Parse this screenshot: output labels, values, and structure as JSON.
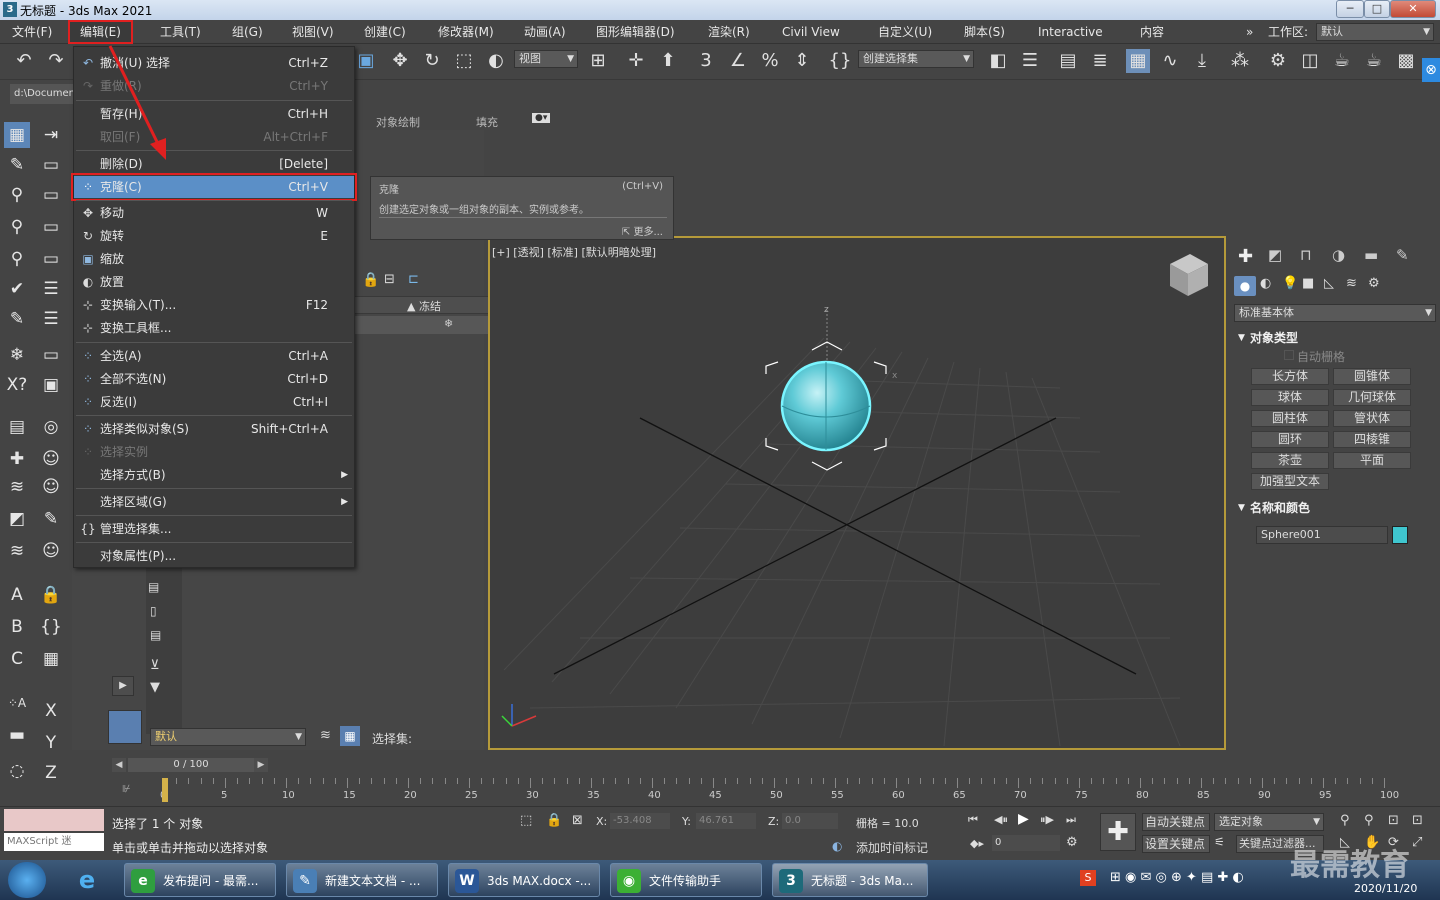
{
  "window": {
    "title": "无标题 - 3ds Max 2021",
    "app_icon": "3",
    "minimize": "─",
    "maximize": "□",
    "close": "✕"
  },
  "menubar": {
    "items": [
      "文件(F)",
      "编辑(E)",
      "工具(T)",
      "组(G)",
      "视图(V)",
      "创建(C)",
      "修改器(M)",
      "动画(A)",
      "图形编辑器(D)",
      "渲染(R)",
      "Civil View",
      "自定义(U)",
      "脚本(S)",
      "Interactive",
      "内容"
    ],
    "workspace_label": "工作区:",
    "workspace_value": "默认",
    "more": "»"
  },
  "toolbar": {
    "view_combo": "视图",
    "selection_set_combo": "创建选择集",
    "path": "d:\\Documents"
  },
  "ribbon": {
    "tab_object_paint": "对象绘制",
    "tab_fill": "填充"
  },
  "edit_menu": {
    "items": [
      {
        "label": "撤消(U) 选择",
        "shortcut": "Ctrl+Z",
        "icon": "↶",
        "disabled": false
      },
      {
        "label": "重做(R)",
        "shortcut": "Ctrl+Y",
        "icon": "↷",
        "disabled": true
      },
      {
        "label": "暂存(H)",
        "shortcut": "Ctrl+H",
        "icon": "",
        "disabled": false
      },
      {
        "label": "取回(F)",
        "shortcut": "Alt+Ctrl+F",
        "icon": "",
        "disabled": true
      },
      {
        "label": "删除(D)",
        "shortcut": "[Delete]",
        "icon": "",
        "disabled": false
      },
      {
        "label": "克隆(C)",
        "shortcut": "Ctrl+V",
        "icon": "⁘",
        "disabled": false
      },
      {
        "label": "移动",
        "shortcut": "W",
        "icon": "✥",
        "disabled": false
      },
      {
        "label": "旋转",
        "shortcut": "E",
        "icon": "↻",
        "disabled": false
      },
      {
        "label": "缩放",
        "shortcut": "",
        "icon": "▣",
        "disabled": false
      },
      {
        "label": "放置",
        "shortcut": "",
        "icon": "◐",
        "disabled": false
      },
      {
        "label": "变换输入(T)...",
        "shortcut": "F12",
        "icon": "⊹",
        "disabled": false
      },
      {
        "label": "变换工具框...",
        "shortcut": "",
        "icon": "⊹",
        "disabled": false
      },
      {
        "label": "全选(A)",
        "shortcut": "Ctrl+A",
        "icon": "⁘",
        "disabled": false
      },
      {
        "label": "全部不选(N)",
        "shortcut": "Ctrl+D",
        "icon": "⁘",
        "disabled": false
      },
      {
        "label": "反选(I)",
        "shortcut": "Ctrl+I",
        "icon": "⁘",
        "disabled": false
      },
      {
        "label": "选择类似对象(S)",
        "shortcut": "Shift+Ctrl+A",
        "icon": "⁘",
        "disabled": false
      },
      {
        "label": "选择实例",
        "shortcut": "",
        "icon": "⁘",
        "disabled": true
      },
      {
        "label": "选择方式(B)",
        "shortcut": "",
        "icon": "",
        "disabled": false,
        "submenu": "▶"
      },
      {
        "label": "选择区域(G)",
        "shortcut": "",
        "icon": "",
        "disabled": false,
        "submenu": "▶"
      },
      {
        "label": "管理选择集...",
        "shortcut": "",
        "icon": "{}",
        "disabled": false
      },
      {
        "label": "对象属性(P)...",
        "shortcut": "",
        "icon": "",
        "disabled": false
      }
    ]
  },
  "tooltip": {
    "title": "克隆",
    "shortcut": "(Ctrl+V)",
    "description": "创建选定对象或一组对象的副本、实例或参考。",
    "more": "更多..."
  },
  "explorer": {
    "freeze_header": "▲ 冻结",
    "freeze_icon": "❄",
    "layer_combo": "默认",
    "selection_set_label": "选择集:"
  },
  "viewport": {
    "label": "[+] [透视] [标准] [默认明暗处理]",
    "axis_z": "z",
    "axis_x": "x"
  },
  "command_panel": {
    "category": "标准基本体",
    "object_type_header": "对象类型",
    "auto_grid": "自动栅格",
    "buttons": [
      "长方体",
      "圆锥体",
      "球体",
      "几何球体",
      "圆柱体",
      "管状体",
      "圆环",
      "四棱锥",
      "茶壶",
      "平面",
      "加强型文本"
    ],
    "name_color_header": "名称和颜色",
    "object_name": "Sphere001",
    "object_color": "#3fc6cf"
  },
  "timeline": {
    "frame_display": "0 / 100",
    "ticks": [
      "0",
      "5",
      "10",
      "15",
      "20",
      "25",
      "30",
      "35",
      "40",
      "45",
      "50",
      "55",
      "60",
      "65",
      "70",
      "75",
      "80",
      "85",
      "90",
      "95",
      "100"
    ]
  },
  "status": {
    "maxscript": "MAXScript 迷",
    "selected": "选择了 1 个 对象",
    "prompt": "单击或单击并拖动以选择对象",
    "x_label": "X:",
    "x_value": "-53.408",
    "y_label": "Y:",
    "y_value": "46.761",
    "z_label": "Z:",
    "z_value": "0.0",
    "grid": "栅格 = 10.0",
    "add_time_tag": "添加时间标记",
    "auto_key": "自动关键点",
    "selected_object": "选定对象",
    "set_key": "设置关键点",
    "key_filters": "关键点过滤器...",
    "frame": "0"
  },
  "taskbar": {
    "tasks": [
      {
        "label": "发布提问 - 最需...",
        "icon": "e",
        "color": "#2f9e3f"
      },
      {
        "label": "新建文本文档 - ...",
        "icon": "✎",
        "color": "#4a7fb5"
      },
      {
        "label": "3ds MAX.docx -...",
        "icon": "W",
        "color": "#2b5797"
      },
      {
        "label": "文件传输助手",
        "icon": "◉",
        "color": "#3cb034"
      },
      {
        "label": "无标题 - 3ds Ma...",
        "icon": "3",
        "color": "#1e6a7a"
      }
    ],
    "clock_date": "2020/11/20",
    "watermark": "最需教育"
  }
}
